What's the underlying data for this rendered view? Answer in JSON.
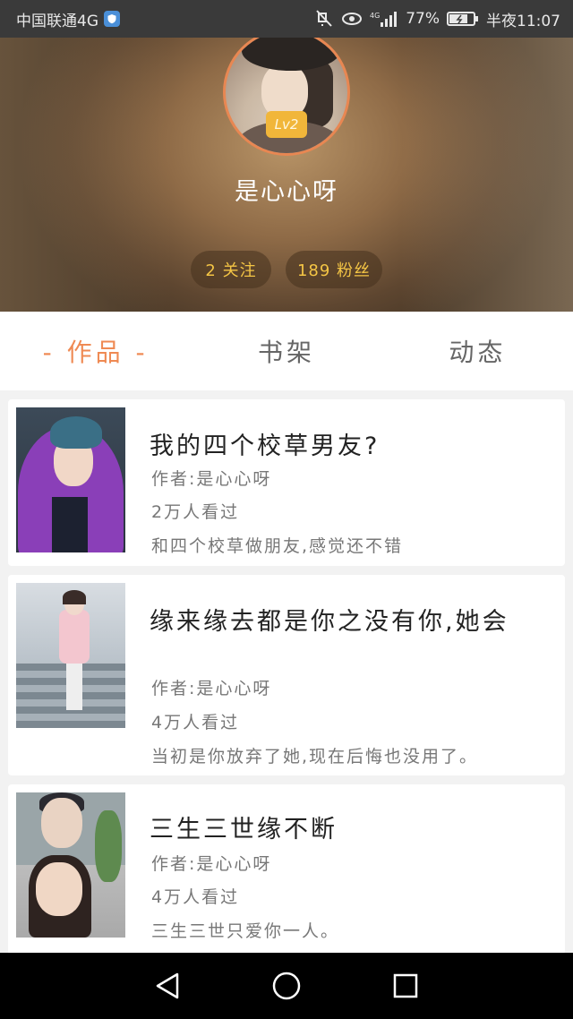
{
  "status_bar": {
    "carrier": "中国联通4G",
    "battery": "77%",
    "time": "半夜11:07",
    "icons": [
      "shield-icon",
      "mute-icon",
      "eye-icon",
      "signal-icon",
      "battery-icon"
    ]
  },
  "profile": {
    "level": "Lv2",
    "username": "是心心呀",
    "follow": "2 关注",
    "fans": "189 粉丝"
  },
  "tabs": [
    {
      "label": "- 作品 -",
      "active": true
    },
    {
      "label": "书架",
      "active": false
    },
    {
      "label": "动态",
      "active": false
    }
  ],
  "books": [
    {
      "title": "我的四个校草男友?",
      "author": "作者:是心心呀",
      "views": "2万人看过",
      "desc": "和四个校草做朋友,感觉还不错"
    },
    {
      "title": "缘来缘去都是你之没有你,她会",
      "author": "作者:是心心呀",
      "views": "4万人看过",
      "desc": "当初是你放弃了她,现在后悔也没用了。"
    },
    {
      "title": "三生三世缘不断",
      "author": "作者:是心心呀",
      "views": "4万人看过",
      "desc": "三生三世只爱你一人。"
    }
  ],
  "nav": [
    "back-icon",
    "home-icon",
    "recents-icon"
  ],
  "colors": {
    "accent": "#ef8a53",
    "badge": "#f1b63a",
    "stat_text": "#f4c545"
  }
}
